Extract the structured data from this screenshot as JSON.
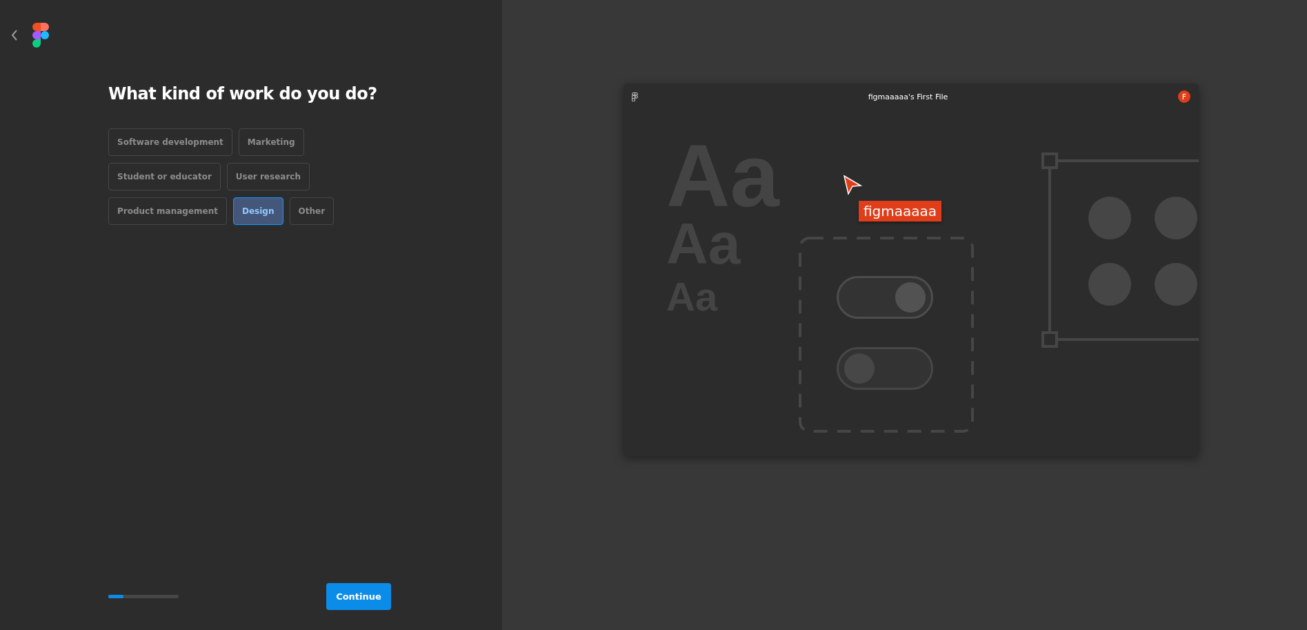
{
  "title": "What kind of work do you do?",
  "option_rows": [
    [
      {
        "label": "Software development",
        "selected": false
      },
      {
        "label": "Marketing",
        "selected": false
      }
    ],
    [
      {
        "label": "Student or educator",
        "selected": false
      },
      {
        "label": "User research",
        "selected": false
      }
    ],
    [
      {
        "label": "Product management",
        "selected": false
      },
      {
        "label": "Design",
        "selected": true
      },
      {
        "label": "Other",
        "selected": false
      }
    ]
  ],
  "progress": {
    "level": 0.22
  },
  "continue_button": "Continue",
  "preview": {
    "file_title": "figmaaaaa's First File",
    "avatar": "F",
    "sample_texts": [
      "Aa",
      "Aa",
      "Aa"
    ],
    "cursor_label": "figmaaaaa",
    "toggles": [
      {
        "on": true
      },
      {
        "on": false
      }
    ]
  }
}
